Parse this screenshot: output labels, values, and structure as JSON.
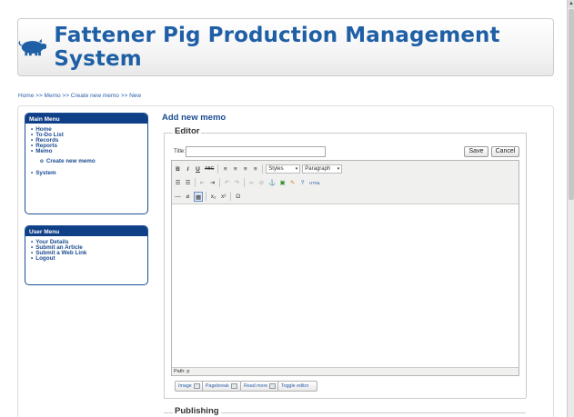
{
  "app": {
    "title": "Fattener Pig Production Management System"
  },
  "breadcrumb": "Home >> Memo >> Create new memo >> New",
  "main_menu": {
    "title": "Main Menu",
    "items": [
      "Home",
      "To-Do List",
      "Records",
      "Reports",
      "Memo"
    ],
    "sub_item": "Create new memo",
    "after_items": [
      "System"
    ]
  },
  "user_menu": {
    "title": "User Menu",
    "items": [
      "Your Details",
      "Submit an Article",
      "Submit a Web Link",
      "Logout"
    ]
  },
  "page": {
    "heading": "Add new memo",
    "editor_legend": "Editor",
    "title_label": "Title:",
    "title_value": "",
    "save_label": "Save",
    "cancel_label": "Cancel",
    "publishing_legend": "Publishing"
  },
  "toolbar": {
    "styles": "Styles",
    "format": "Paragraph",
    "row1": [
      "B",
      "I",
      "U",
      "ABC"
    ],
    "subscript": "x₂",
    "superscript": "x²",
    "omega": "Ω",
    "html": "HTML"
  },
  "editor": {
    "path": "Path: p"
  },
  "editor_buttons": [
    "Image",
    "Pagebreak",
    "Read more",
    "Toggle editor"
  ]
}
